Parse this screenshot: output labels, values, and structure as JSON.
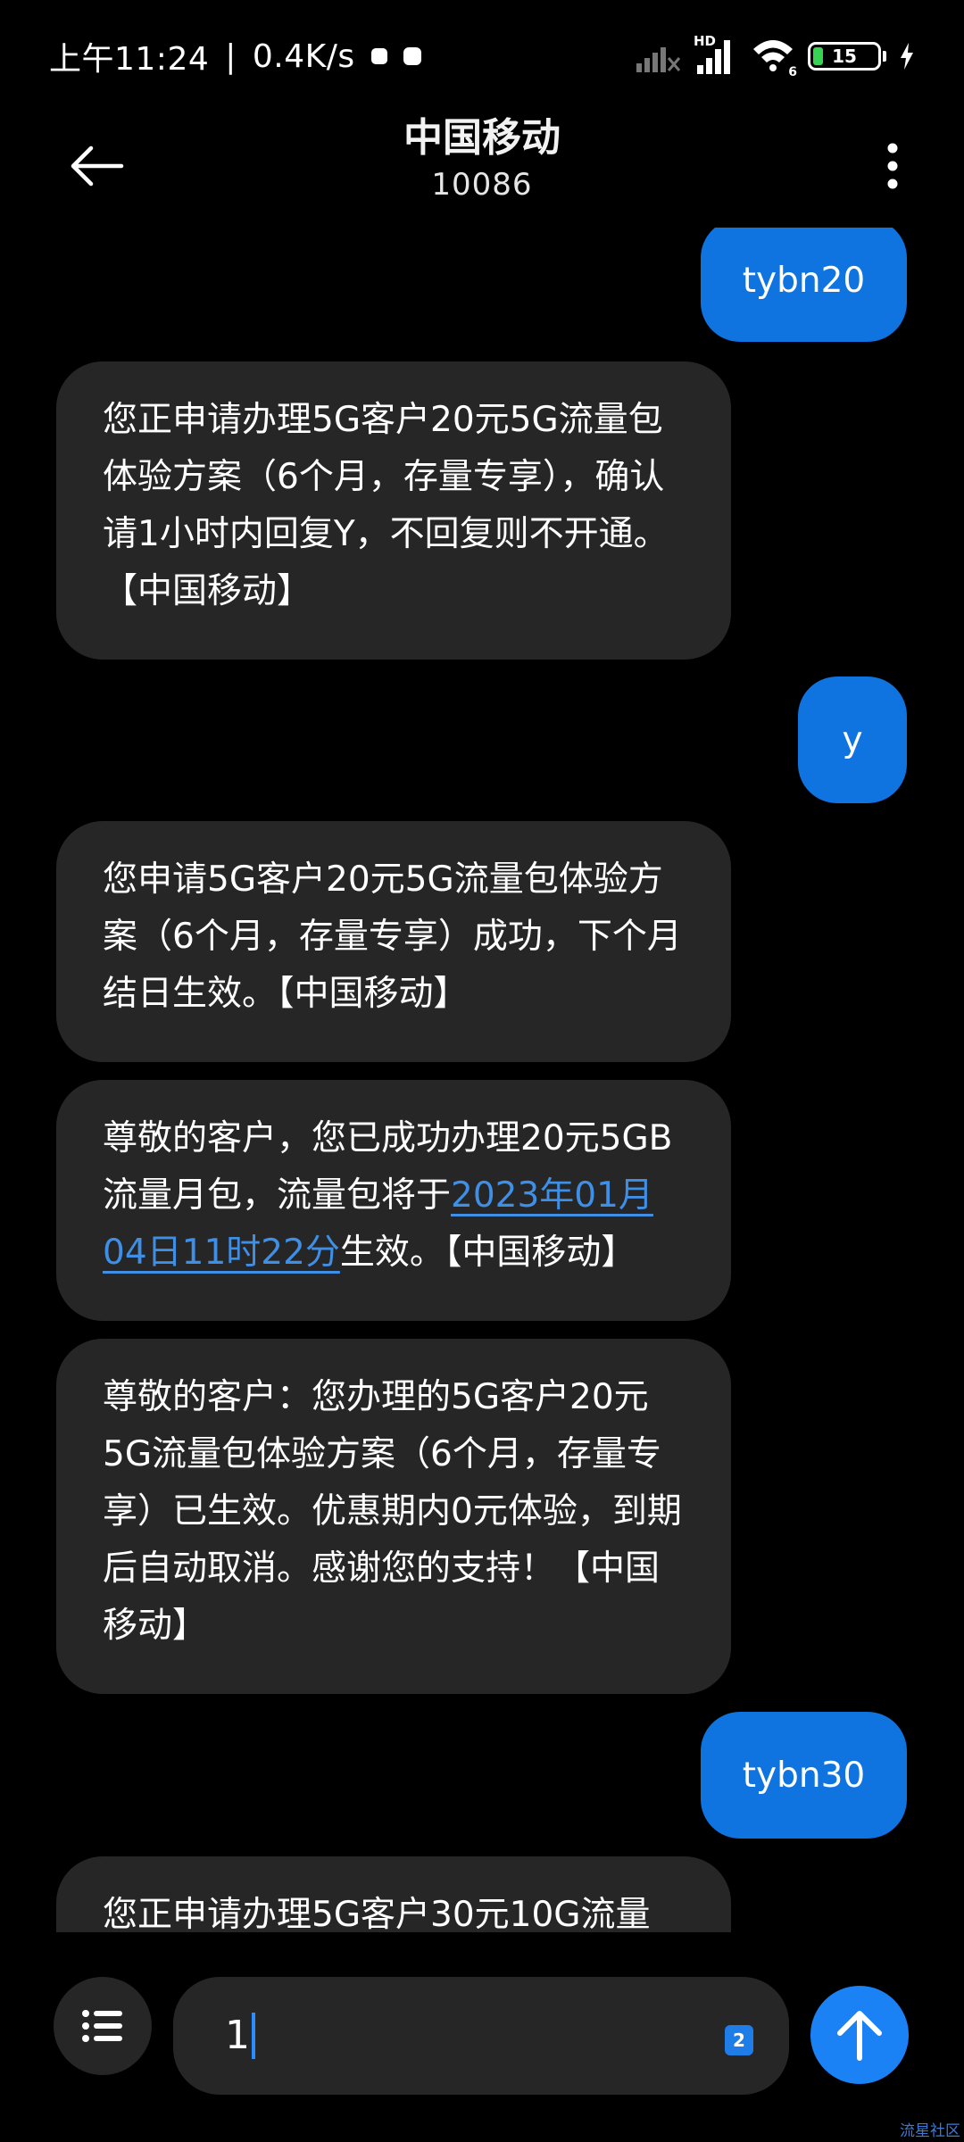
{
  "status_bar": {
    "time": "上午11:24",
    "separator": "|",
    "speed": "0.4K/s",
    "network_tag": "HD",
    "wifi_tag": "6",
    "battery": "15",
    "battery_level": 0.15
  },
  "header": {
    "title": "中国移动",
    "number": "10086"
  },
  "messages": [
    {
      "dir": "out",
      "text": "tybn20"
    },
    {
      "dir": "in",
      "text": "您正申请办理5G客户20元5G流量包体验方案（6个月，存量专享），确认请1小时内回复Y，不回复则不开通。【中国移动】"
    },
    {
      "dir": "out",
      "text": "y"
    },
    {
      "dir": "in",
      "text": "您申请5G客户20元5G流量包体验方案（6个月，存量专享）成功，下个月结日生效。【中国移动】"
    },
    {
      "dir": "in",
      "text_before": "尊敬的客户，您已成功办理20元5GB流量月包，流量包将于",
      "link": "2023年01月04日11时22分",
      "text_after": "生效。【中国移动】"
    },
    {
      "dir": "in",
      "text": "尊敬的客户：您办理的5G客户20元5G流量包体验方案（6个月，存量专享）已生效。优惠期内0元体验，到期后自动取消。感谢您的支持！【中国移动】"
    },
    {
      "dir": "out",
      "text": "tybn30"
    },
    {
      "dir": "in",
      "text": "您正申请办理5G客户30元10G流量"
    }
  ],
  "composer": {
    "value": "1",
    "sim_slot": "2"
  },
  "watermark": "流星社区",
  "colors": {
    "background": "#000000",
    "incoming_bubble": "#262626",
    "outgoing_bubble": "#0f73e0",
    "send_button": "#1a82f5",
    "link": "#3f8fe6"
  }
}
